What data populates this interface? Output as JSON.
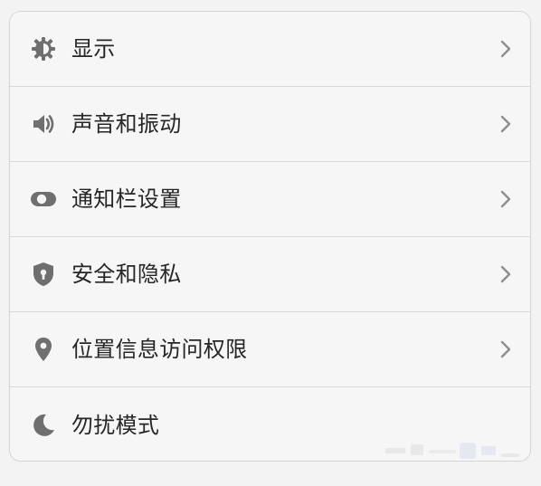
{
  "settings": {
    "items": [
      {
        "icon": "brightness-icon",
        "label": "显示",
        "has_chevron": true
      },
      {
        "icon": "speaker-icon",
        "label": "声音和振动",
        "has_chevron": true
      },
      {
        "icon": "toggle-icon",
        "label": "通知栏设置",
        "has_chevron": true
      },
      {
        "icon": "shield-lock-icon",
        "label": "安全和隐私",
        "has_chevron": true
      },
      {
        "icon": "location-pin-icon",
        "label": "位置信息访问权限",
        "has_chevron": true
      },
      {
        "icon": "moon-icon",
        "label": "勿扰模式",
        "has_chevron": false
      }
    ]
  },
  "colors": {
    "background": "#f3f3f3",
    "card": "#f6f6f6",
    "divider": "#d9d9d9",
    "text": "#262626",
    "icon": "#6f6f6f",
    "chevron": "#8e8e8e"
  }
}
